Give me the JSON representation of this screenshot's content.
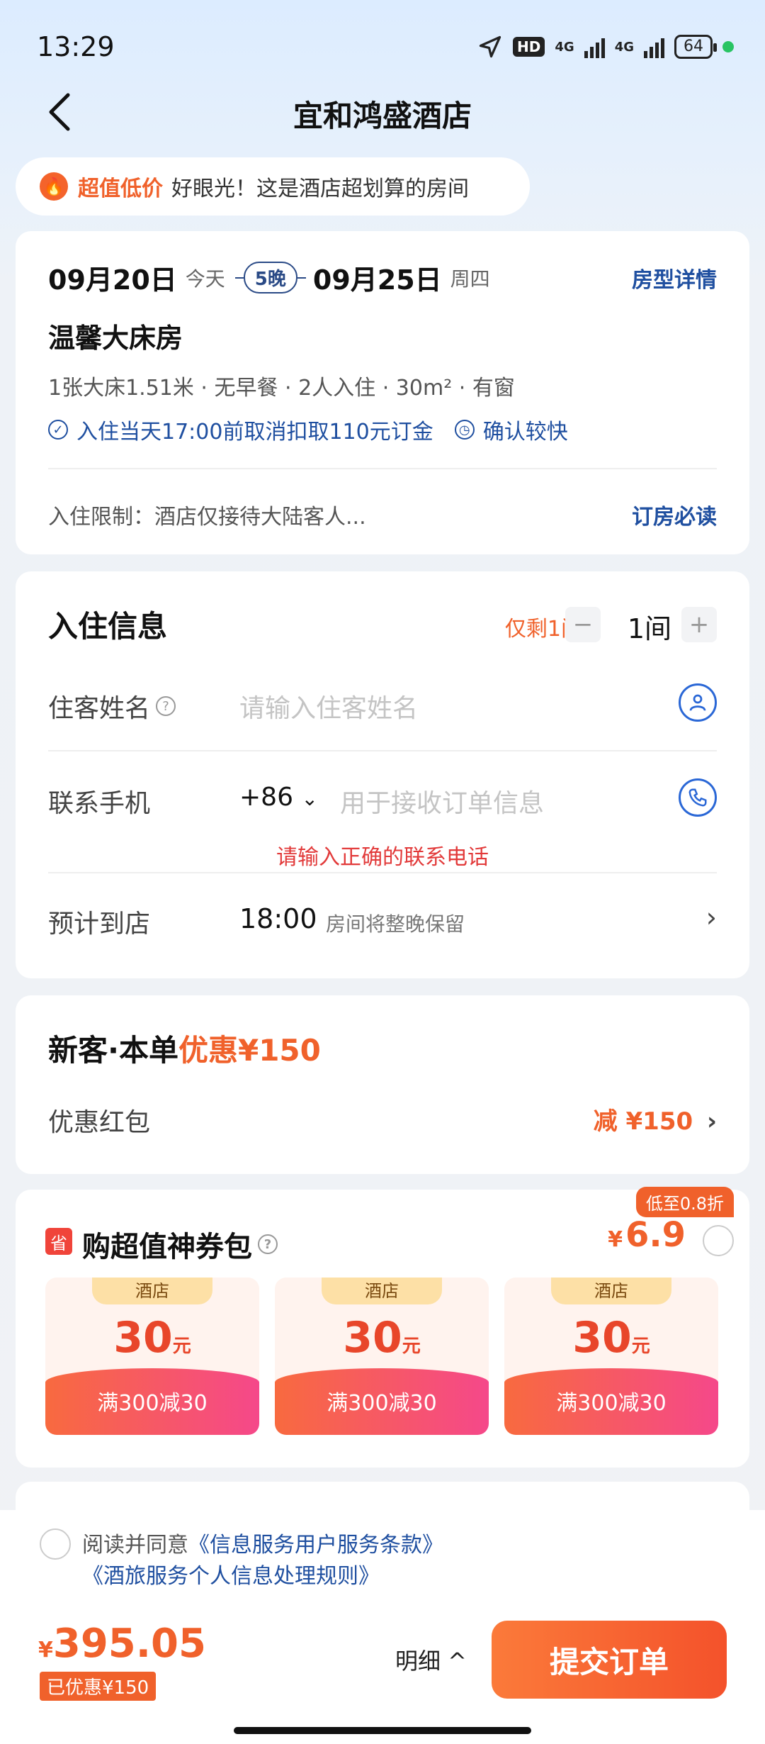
{
  "status_bar": {
    "time": "13:29",
    "battery": "64",
    "hd": "HD",
    "net1": "4G",
    "net2": "4G"
  },
  "header": {
    "title": "宜和鸿盛酒店"
  },
  "promo": {
    "highlight": "超值低价",
    "text": "好眼光！这是酒店超划算的房间"
  },
  "booking": {
    "checkin_date": "09月20日",
    "checkin_day": "今天",
    "nights": "5晚",
    "checkout_date": "09月25日",
    "checkout_day": "周四",
    "room_detail_link": "房型详情",
    "room_name": "温馨大床房",
    "room_meta": "1张大床1.51米 · 无早餐 · 2人入住 · 30m² · 有窗",
    "cancel_policy": "入住当天17:00前取消扣取110元订金",
    "confirm": "确认较快",
    "restriction": "入住限制：酒店仅接待大陆客人...",
    "must_read": "订房必读"
  },
  "guest_info": {
    "title": "入住信息",
    "rooms_left": "仅剩1间",
    "room_count": "1间",
    "minus": "−",
    "plus": "+",
    "name_label": "住客姓名",
    "name_placeholder": "请输入住客姓名",
    "phone_label": "联系手机",
    "country_code": "+86",
    "phone_placeholder": "用于接收订单信息",
    "phone_error": "请输入正确的联系电话",
    "arrival_label": "预计到店",
    "arrival_time": "18:00",
    "arrival_hint": "房间将整晚保留"
  },
  "discount": {
    "title_prefix": "新客·本单",
    "title_highlight": "优惠¥150",
    "redpacket_label": "优惠红包",
    "redpacket_value": "减 ¥150"
  },
  "coupon_pack": {
    "badge": "省",
    "title": "购超值神券包",
    "low_tag": "低至0.8折",
    "currency": "¥",
    "price": "6.9",
    "coupons": [
      {
        "tag": "酒店",
        "amount": "30",
        "unit": "元",
        "rule": "满300减30"
      },
      {
        "tag": "酒店",
        "amount": "30",
        "unit": "元",
        "rule": "满300减30"
      },
      {
        "tag": "酒店",
        "amount": "30",
        "unit": "元",
        "rule": "满300减30"
      }
    ]
  },
  "footer": {
    "agree_prefix": "阅读并同意",
    "agree_link1": "《信息服务用户服务条款》",
    "agree_link2": "《酒旅服务个人信息处理规则》",
    "currency": "¥",
    "total": "395.05",
    "saved": "已优惠¥150",
    "detail": "明细 ^",
    "submit": "提交订单"
  }
}
